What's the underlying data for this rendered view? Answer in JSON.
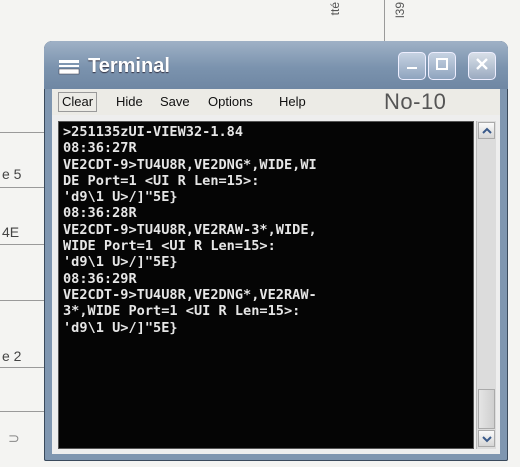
{
  "background": {
    "fragments": [
      "e 5",
      "4E",
      "e 2",
      "⊃"
    ],
    "vertical_texts": [
      "tté",
      "l39"
    ]
  },
  "window": {
    "title": "Terminal",
    "menu": [
      "Clear",
      "Hide",
      "Save",
      "Options",
      "Help"
    ],
    "overlay_label": "No-10"
  },
  "console": {
    "lines": [
      ">251135zUI-VIEW32-1.84",
      "08:36:27R",
      "VE2CDT-9>TU4U8R,VE2DNG*,WIDE,WI",
      "DE Port=1 <UI R Len=15>:",
      "'d9\\1 U>/]\"5E}",
      "08:36:28R",
      "VE2CDT-9>TU4U8R,VE2RAW-3*,WIDE,",
      "WIDE Port=1 <UI R Len=15>:",
      "'d9\\1 U>/]\"5E}",
      "08:36:29R",
      "VE2CDT-9>TU4U8R,VE2DNG*,VE2RAW-",
      "3*,WIDE Port=1 <UI R Len=15>:",
      "'d9\\1 U>/]\"5E}"
    ]
  },
  "icons": {
    "title": "terminal-icon",
    "minimize": "minimize-icon",
    "maximize": "maximize-icon",
    "close": "close-icon",
    "scroll_up": "scroll-up-icon",
    "scroll_down": "scroll-down-icon"
  },
  "colors": {
    "titlebar": "#7b93ae",
    "console_bg": "#050505",
    "console_text": "#e6e6e6"
  }
}
